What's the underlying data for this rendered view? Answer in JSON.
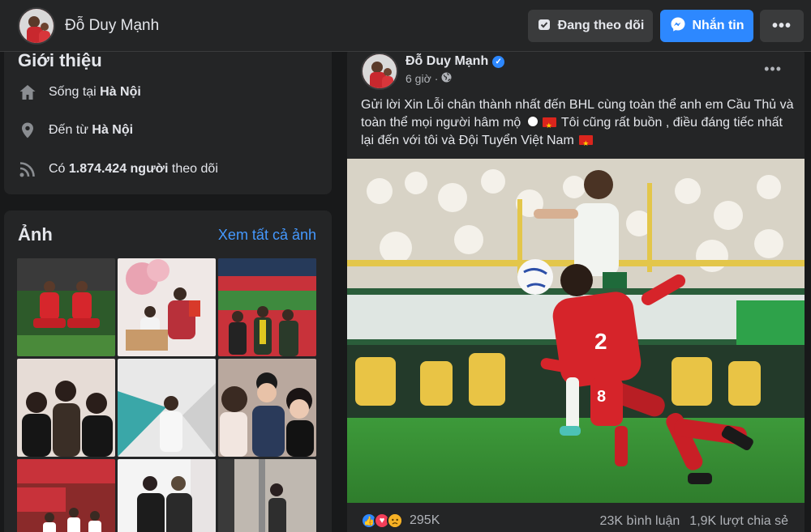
{
  "header": {
    "name": "Đỗ Duy Mạnh",
    "follow_label": "Đang theo dõi",
    "message_label": "Nhắn tin",
    "more_label": "•••"
  },
  "intro": {
    "title": "Giới thiệu",
    "lives_prefix": "Sống tại ",
    "lives_city": "Hà Nội",
    "from_prefix": "Đến từ ",
    "from_city": "Hà Nội",
    "followers_prefix": "Có ",
    "followers_count": "1.874.424 người",
    "followers_suffix": " theo dõi"
  },
  "photos": {
    "title": "Ảnh",
    "see_all": "Xem tất cả ảnh"
  },
  "post": {
    "author": "Đỗ Duy Mạnh",
    "time": "6 giờ",
    "separator": "·",
    "more_label": "•••",
    "text_part1": "Gửi lời Xin Lỗi chân thành nhất đến BHL cùng toàn thể anh em Cầu Thủ và toàn thể mọi người hâm mộ ",
    "text_part2": " Tôi cũng rất buồn , điều đáng tiếc nhất lại đến với tôi và Đội Tuyển Việt Nam ",
    "reaction_count": "295K",
    "comments": "23K bình luận",
    "shares": "1,9K lượt chia sẻ"
  },
  "colors": {
    "background": "#18191a",
    "card": "#242526",
    "accent": "#2d88ff",
    "link": "#4599ff"
  }
}
